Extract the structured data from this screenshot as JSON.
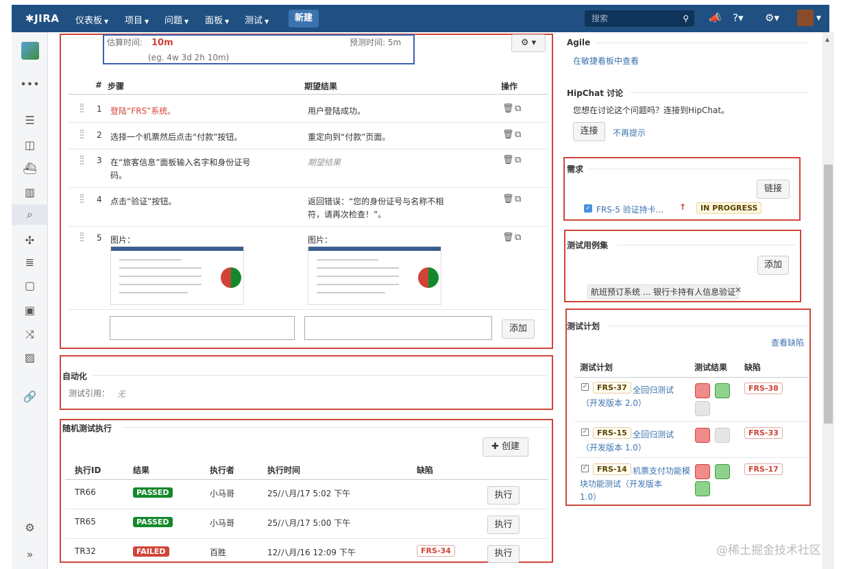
{
  "topnav": {
    "logo": "JIRA",
    "items": [
      {
        "label": "仪表板"
      },
      {
        "label": "项目"
      },
      {
        "label": "问题"
      },
      {
        "label": "面板"
      },
      {
        "label": "测试"
      }
    ],
    "create_label": "新建",
    "search_placeholder": "搜索"
  },
  "steps": {
    "estimate_label": "估算时间:",
    "estimate_value": "10m",
    "estimate_hint": "(eg. 4w 3d 2h 10m)",
    "forecast": "预测时间: 5m",
    "headers": {
      "num": "#",
      "step": "步骤",
      "expected": "期望结果",
      "ops": "操作"
    },
    "rows": [
      {
        "num": "1",
        "step": "登陆“FRS”系统。",
        "expected": "用户登陆成功。"
      },
      {
        "num": "2",
        "step": "选择一个机票然后点击“付款”按钮。",
        "expected": "重定向到“付款”页面。"
      },
      {
        "num": "3",
        "step": "在“旅客信息”面板输入名字和身份证号",
        "step_line2": "码。",
        "expected": "期望结果"
      },
      {
        "num": "4",
        "step": "点击“验证”按钮。",
        "expected": "返回错误：“您的身份证号与名称不相",
        "expected_line2": "符，请再次检查！”。"
      },
      {
        "num": "5",
        "step": "图片：",
        "expected": "图片："
      }
    ],
    "add_label": "添加"
  },
  "automation": {
    "title": "自动化",
    "ref_label": "测试引用：",
    "ref_value": "无"
  },
  "adhoc": {
    "title": "随机测试执行",
    "create_label": "创建",
    "headers": {
      "id": "执行ID",
      "result": "结果",
      "executor": "执行者",
      "time": "执行时间",
      "defect": "缺陷"
    },
    "rows": [
      {
        "id": "TR66",
        "result": "PASSED",
        "executor": "小马哥",
        "time": "25/八月/17 5:02 下午",
        "defect": "",
        "action": "执行"
      },
      {
        "id": "TR65",
        "result": "PASSED",
        "executor": "小马哥",
        "time": "25/八月/17 5:00 下午",
        "defect": "",
        "action": "执行"
      },
      {
        "id": "TR32",
        "result": "FAILED",
        "executor": "百胜",
        "time": "12/八月/16 12:09 下午",
        "defect": "FRS-34",
        "action": "执行"
      }
    ]
  },
  "agile": {
    "title": "Agile",
    "link": "在敏捷看板中查看"
  },
  "hipchat": {
    "title": "HipChat 讨论",
    "prompt": "您想在讨论这个问题吗？连接到HipChat。",
    "connect": "连接",
    "dismiss": "不再提示"
  },
  "requirements": {
    "title": "需求",
    "link_btn": "链接",
    "item": "FRS-5 验证持卡...",
    "status": "IN PROGRESS"
  },
  "testsets": {
    "title": "测试用例集",
    "add": "添加",
    "item": "航班预订系统 ... 银行卡持有人信息验证"
  },
  "testplans": {
    "title": "测试计划",
    "view_defects": "查看缺陷",
    "headers": {
      "plan": "测试计划",
      "result": "测试结果",
      "defect": "缺陷"
    },
    "rows": [
      {
        "key": "FRS-37",
        "name": "全回归测试",
        "line2": "（开发版本 2.0）",
        "defect": "FRS-38"
      },
      {
        "key": "FRS-15",
        "name": "全回归测试",
        "line2": "（开发版本 1.0）",
        "defect": "FRS-33"
      },
      {
        "key": "FRS-14",
        "name": "机票支付功能模",
        "line2": "块功能测试（开发版本",
        "line3": "1.0）",
        "defect": "FRS-17"
      }
    ]
  },
  "watermark": "@稀土掘金技术社区"
}
